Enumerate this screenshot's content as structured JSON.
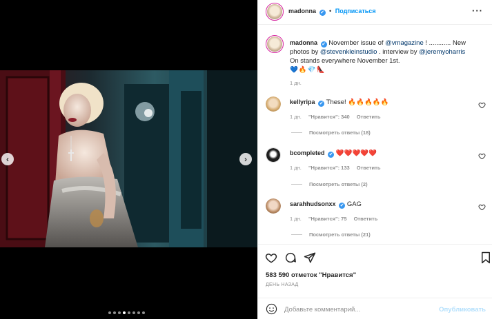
{
  "post": {
    "username": "madonna",
    "verified_mark": "✔",
    "separator": "•",
    "follow_label": "Подписаться",
    "more_label": "···",
    "caption": {
      "text_1": "November issue of ",
      "mention_1": "@vmagazine",
      "text_2": " ! ............ New photos by ",
      "mention_2": "@stevenkleinstudio",
      "text_3": " . interview by ",
      "mention_3": "@jeremyoharris",
      "line_2": "On stands everywhere November 1st.",
      "emojis": "💙🔥💎👠"
    },
    "caption_age": "1 дн."
  },
  "comments": [
    {
      "username": "kellyripa",
      "verified_mark": "✔",
      "text": "These! 🔥🔥🔥🔥🔥",
      "age": "1 дн.",
      "likes": "\"Нравится\": 340",
      "reply": "Ответить",
      "replies": "Посмотреть ответы (18)"
    },
    {
      "username": "bcompleted",
      "verified_mark": "✔",
      "text": "❤️❤️❤️❤️❤️",
      "age": "1 дн.",
      "likes": "\"Нравится\": 133",
      "reply": "Ответить",
      "replies": "Посмотреть ответы (2)"
    },
    {
      "username": "sarahhudsonxx",
      "verified_mark": "✔",
      "text": "GAG",
      "age": "1 дн.",
      "likes": "\"Нравится\": 75",
      "reply": "Ответить",
      "replies": "Посмотреть ответы (21)"
    }
  ],
  "actions": {
    "like_count": "583 590 отметок \"Нравится\"",
    "timestamp": "ДЕНЬ НАЗАД"
  },
  "comment_box": {
    "placeholder": "Добавьте комментарий...",
    "publish_label": "Опубликовать"
  },
  "carousel": {
    "prev_glyph": "‹",
    "next_glyph": "›",
    "slide_count": 8,
    "active_index": 3
  },
  "colors": {
    "accent": "#0095f6",
    "verified": "#3897f0",
    "publish_disabled": "#b2dffc"
  }
}
